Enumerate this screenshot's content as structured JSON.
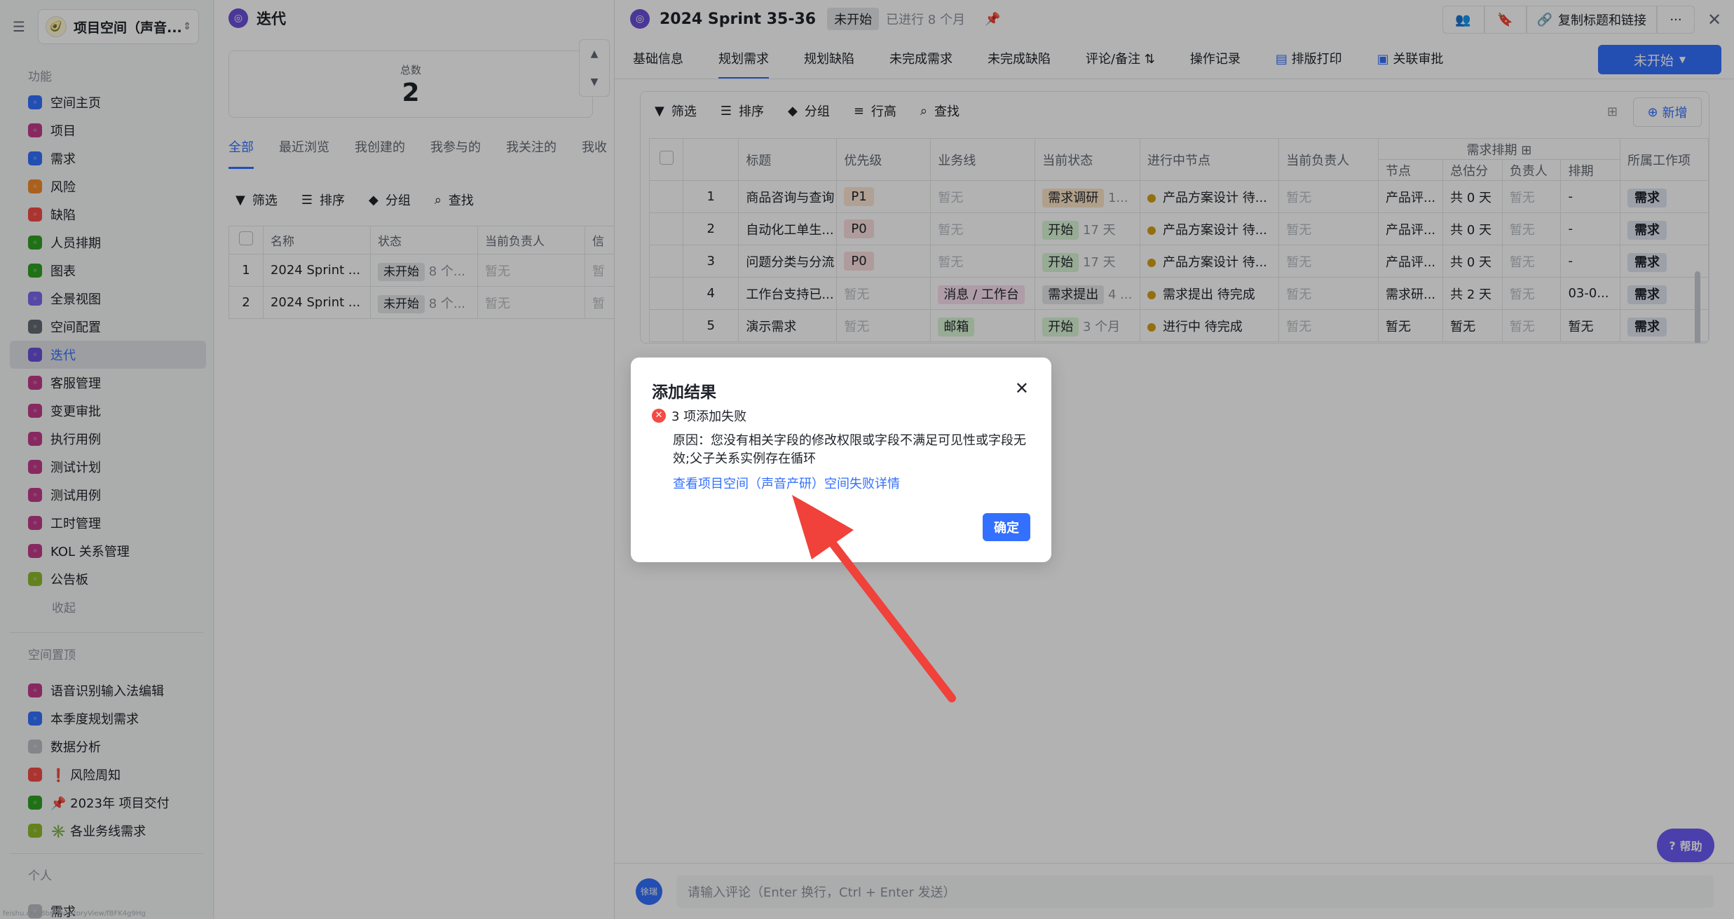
{
  "sidebar": {
    "space_name": "项目空间（声音...",
    "section_features": "功能",
    "items": [
      {
        "label": "空间主页",
        "color": "#3370ff"
      },
      {
        "label": "项目",
        "color": "#c23b8a"
      },
      {
        "label": "需求",
        "color": "#3370ff"
      },
      {
        "label": "风险",
        "color": "#f58b2c"
      },
      {
        "label": "缺陷",
        "color": "#f54a45"
      },
      {
        "label": "人员排期",
        "color": "#2ea121"
      },
      {
        "label": "图表",
        "color": "#2ea121"
      },
      {
        "label": "全景视图",
        "color": "#7b67ee"
      },
      {
        "label": "空间配置",
        "color": "#646a73"
      },
      {
        "label": "迭代",
        "color": "#6b4fd8"
      },
      {
        "label": "客服管理",
        "color": "#c23b8a"
      },
      {
        "label": "变更审批",
        "color": "#c23b8a"
      },
      {
        "label": "执行用例",
        "color": "#c23b8a"
      },
      {
        "label": "测试计划",
        "color": "#c23b8a"
      },
      {
        "label": "测试用例",
        "color": "#c23b8a"
      },
      {
        "label": "工时管理",
        "color": "#c23b8a"
      },
      {
        "label": "KOL 关系管理",
        "color": "#c23b8a"
      },
      {
        "label": "公告板",
        "color": "#8fbb2a"
      }
    ],
    "collapse_label": "收起",
    "section_pinned": "空间置顶",
    "pinned": [
      {
        "label": "语音识别输入法编辑",
        "color": "#c23b8a"
      },
      {
        "label": "本季度规划需求",
        "color": "#3370ff"
      },
      {
        "label": "数据分析",
        "color": "#bbbfc4"
      },
      {
        "label": "❗ 风险周知",
        "color": "#f54a45"
      },
      {
        "label": "📌 2023年 项目交付",
        "color": "#2ea121"
      },
      {
        "label": "✳️ 各业务线需求",
        "color": "#8fbb2a"
      }
    ],
    "section_personal": "个人",
    "personal": [
      {
        "label": "需求",
        "color": "#bbbfc4"
      }
    ],
    "footer_url": "feishu.cn/c8bgnbd/storyView/fBFK4g9Hg"
  },
  "middle": {
    "title": "迭代",
    "total_label": "总数",
    "total_value": "2",
    "tabs": [
      "全部",
      "最近浏览",
      "我创建的",
      "我参与的",
      "我关注的",
      "我收"
    ],
    "toolbar": [
      "筛选",
      "排序",
      "分组",
      "查找"
    ],
    "table": {
      "headers": [
        "名称",
        "状态",
        "当前负责人",
        "信"
      ],
      "rows": [
        {
          "index": "1",
          "name": "2024 Sprint ...",
          "status": "未开始",
          "dur": "8 个...",
          "owner": "暂无",
          "extra": "暂"
        },
        {
          "index": "2",
          "name": "2024 Sprint ...",
          "status": "未开始",
          "dur": "8 个...",
          "owner": "暂无",
          "extra": "暂"
        }
      ]
    }
  },
  "drawer": {
    "title": "2024 Sprint 35-36",
    "status": "未开始",
    "progress": "已进行 8 个月",
    "copy_label": "复制标题和链接",
    "tabs": [
      "基础信息",
      "规划需求",
      "规划缺陷",
      "未完成需求",
      "未完成缺陷",
      "评论/备注",
      "操作记录",
      "排版打印",
      "关联审批"
    ],
    "active_tab": "规划需求",
    "start_button": "未开始",
    "toolbar": [
      "筛选",
      "排序",
      "分组",
      "行高",
      "查找"
    ],
    "new_button": "新增",
    "table": {
      "group_header": "需求排期",
      "headers": [
        "标题",
        "优先级",
        "业务线",
        "当前状态",
        "进行中节点",
        "当前负责人",
        "节点",
        "总估分",
        "负责人",
        "排期",
        "所属工作项"
      ],
      "rows": [
        {
          "index": "1",
          "title": "商品咨询与查询",
          "priority": "P1",
          "biz": "暂无",
          "state": "需求调研",
          "state_dur": "1...",
          "node": "产品方案设计 待...",
          "owner": "暂无",
          "sched_node": "产品评...",
          "score": "共 0 天",
          "sched_owner": "暂无",
          "sched": "-",
          "type": "需求"
        },
        {
          "index": "2",
          "title": "自动化工单生...",
          "priority": "P0",
          "biz": "暂无",
          "state": "开始",
          "state_dur": "17 天",
          "node": "产品方案设计 待...",
          "owner": "暂无",
          "sched_node": "产品评...",
          "score": "共 0 天",
          "sched_owner": "暂无",
          "sched": "-",
          "type": "需求"
        },
        {
          "index": "3",
          "title": "问题分类与分流",
          "priority": "P0",
          "biz": "暂无",
          "state": "开始",
          "state_dur": "17 天",
          "node": "产品方案设计 待...",
          "owner": "暂无",
          "sched_node": "产品评...",
          "score": "共 0 天",
          "sched_owner": "暂无",
          "sched": "-",
          "type": "需求"
        },
        {
          "index": "4",
          "title": "工作台支持已...",
          "priority": "暂无",
          "biz": "消息 / 工作台",
          "state": "需求提出",
          "state_dur": "4 ...",
          "node": "需求提出 待完成",
          "owner": "暂无",
          "sched_node": "需求研...",
          "score": "共 2 天",
          "sched_owner": "暂无",
          "sched": "03-0...",
          "type": "需求"
        },
        {
          "index": "5",
          "title": "演示需求",
          "priority": "暂无",
          "biz": "邮箱",
          "state": "开始",
          "state_dur": "3 个月",
          "node": "进行中 待完成",
          "owner": "暂无",
          "sched_node": "暂无",
          "score": "暂无",
          "sched_owner": "暂无",
          "sched": "暂无",
          "type": "需求"
        }
      ]
    },
    "comment_user": "徐瑞",
    "comment_placeholder": "请输入评论（Enter 换行，Ctrl + Enter 发送）",
    "help_label": "帮助"
  },
  "modal": {
    "title": "添加结果",
    "fail_text": "3 项添加失败",
    "reason": "原因：您没有相关字段的修改权限或字段不满足可见性或字段无效;父子关系实例存在循环",
    "link": "查看项目空间（声音产研）空间失败详情",
    "ok": "确定"
  },
  "colors": {
    "accent": "#3370ff",
    "error": "#f54a45",
    "arrow": "#f0413a"
  }
}
